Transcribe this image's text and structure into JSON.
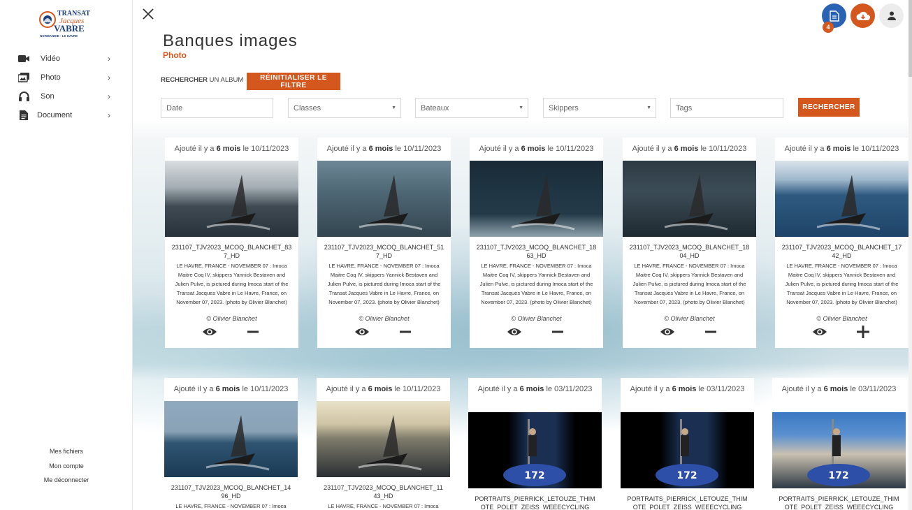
{
  "sidebar": {
    "logo": {
      "line1": "TRANSAT",
      "line2": "Jacques",
      "line3": "VABRE",
      "line4": "NORMANDIE - LE HAVRE"
    },
    "items": [
      {
        "label": "Vidéo",
        "icon": "video-icon"
      },
      {
        "label": "Photo",
        "icon": "photo-icon"
      },
      {
        "label": "Son",
        "icon": "headphones-icon"
      },
      {
        "label": "Document",
        "icon": "document-icon"
      }
    ],
    "bottom_links": [
      "Mes fichiers",
      "Mon compte",
      "Me déconnecter"
    ]
  },
  "header": {
    "title": "Banques images",
    "subtitle": "Photo",
    "cart_badge": "4"
  },
  "filters": {
    "label_bold": "RECHERCHER",
    "label_rest": " UN ALBUM",
    "reset_label": "RÉINITIALISER LE FILTRE",
    "date_placeholder": "Date",
    "classes": "Classes",
    "bateaux": "Bateaux",
    "skippers": "Skippers",
    "tags_placeholder": "Tags",
    "search_label": "RECHERCHER"
  },
  "colors": {
    "accent": "#d4571e",
    "blue": "#2a63b3"
  },
  "cards": [
    {
      "date_pre": "Ajouté il y a ",
      "date_bold": "6 mois",
      "date_post": " le 10/11/2023",
      "filename": "231107_TJV2023_MCOQ_BLANCHET_837_HD",
      "desc": "LE HAVRE, FRANCE - NOVEMBER 07 : Imoca Maitre Coq IV, skippers Yannick Bestaven and Julien Pulve, is pictured during Imoca start of the Transat Jacques Vabre in Le Havre, France, on November 07, 2023. (photo by Olivier Blanchet)",
      "credit": "© Olivier Blanchet",
      "action": "minus"
    },
    {
      "date_pre": "Ajouté il y a ",
      "date_bold": "6 mois",
      "date_post": " le 10/11/2023",
      "filename": "231107_TJV2023_MCOQ_BLANCHET_517_HD",
      "desc": "LE HAVRE, FRANCE - NOVEMBER 07 : Imoca Maitre Coq IV, skippers Yannick Bestaven and Julien Pulve, is pictured during Imoca start of the Transat Jacques Vabre in Le Havre, France, on November 07, 2023. (photo by Olivier Blanchet)",
      "credit": "© Olivier Blanchet",
      "action": "minus"
    },
    {
      "date_pre": "Ajouté il y a ",
      "date_bold": "6 mois",
      "date_post": " le 10/11/2023",
      "filename": "231107_TJV2023_MCOQ_BLANCHET_1863_HD",
      "desc": "LE HAVRE, FRANCE - NOVEMBER 07 : Imoca Maitre Coq IV, skippers Yannick Bestaven and Julien Pulve, is pictured during Imoca start of the Transat Jacques Vabre in Le Havre, France, on November 07, 2023. (photo by Olivier Blanchet)",
      "credit": "© Olivier Blanchet",
      "action": "minus"
    },
    {
      "date_pre": "Ajouté il y a ",
      "date_bold": "6 mois",
      "date_post": " le 10/11/2023",
      "filename": "231107_TJV2023_MCOQ_BLANCHET_1804_HD",
      "desc": "LE HAVRE, FRANCE - NOVEMBER 07 : Imoca Maitre Coq IV, skippers Yannick Bestaven and Julien Pulve, is pictured during Imoca start of the Transat Jacques Vabre in Le Havre, France, on November 07, 2023. (photo by Olivier Blanchet)",
      "credit": "© Olivier Blanchet",
      "action": "minus"
    },
    {
      "date_pre": "Ajouté il y a ",
      "date_bold": "6 mois",
      "date_post": " le 10/11/2023",
      "filename": "231107_TJV2023_MCOQ_BLANCHET_1742_HD",
      "desc": "LE HAVRE, FRANCE - NOVEMBER 07 : Imoca Maitre Coq IV, skippers Yannick Bestaven and Julien Pulve, is pictured during Imoca start of the Transat Jacques Vabre in Le Havre, France, on November 07, 2023. (photo by Olivier Blanchet)",
      "credit": "© Olivier Blanchet",
      "action": "plus"
    },
    {
      "date_pre": "Ajouté il y a ",
      "date_bold": "6 mois",
      "date_post": " le 10/11/2023",
      "filename": "231107_TJV2023_MCOQ_BLANCHET_1496_HD",
      "desc": "LE HAVRE, FRANCE - NOVEMBER 07 : Imoca",
      "credit": "",
      "action": ""
    },
    {
      "date_pre": "Ajouté il y a ",
      "date_bold": "6 mois",
      "date_post": " le 10/11/2023",
      "filename": "231107_TJV2023_MCOQ_BLANCHET_1143_HD",
      "desc": "LE HAVRE, FRANCE - NOVEMBER 07 : Imoca",
      "credit": "",
      "action": ""
    },
    {
      "date_pre": "Ajouté il y a ",
      "date_bold": "6 mois",
      "date_post": " le 03/11/2023",
      "filename": "PORTRAITS_PIERRICK_LETOUZE_THIMOTE_POLET_ZEISS_WEEECYCLING",
      "desc": "",
      "credit": "",
      "action": ""
    },
    {
      "date_pre": "Ajouté il y a ",
      "date_bold": "6 mois",
      "date_post": " le 03/11/2023",
      "filename": "PORTRAITS_PIERRICK_LETOUZE_THIMOTE_POLET_ZEISS_WEEECYCLING",
      "desc": "",
      "credit": "",
      "action": ""
    },
    {
      "date_pre": "Ajouté il y a ",
      "date_bold": "6 mois",
      "date_post": " le 03/11/2023",
      "filename": "PORTRAITS_PIERRICK_LETOUZE_THIMOTE_POLET_ZEISS_WEEECYCLING",
      "desc": "",
      "credit": "",
      "action": ""
    }
  ]
}
